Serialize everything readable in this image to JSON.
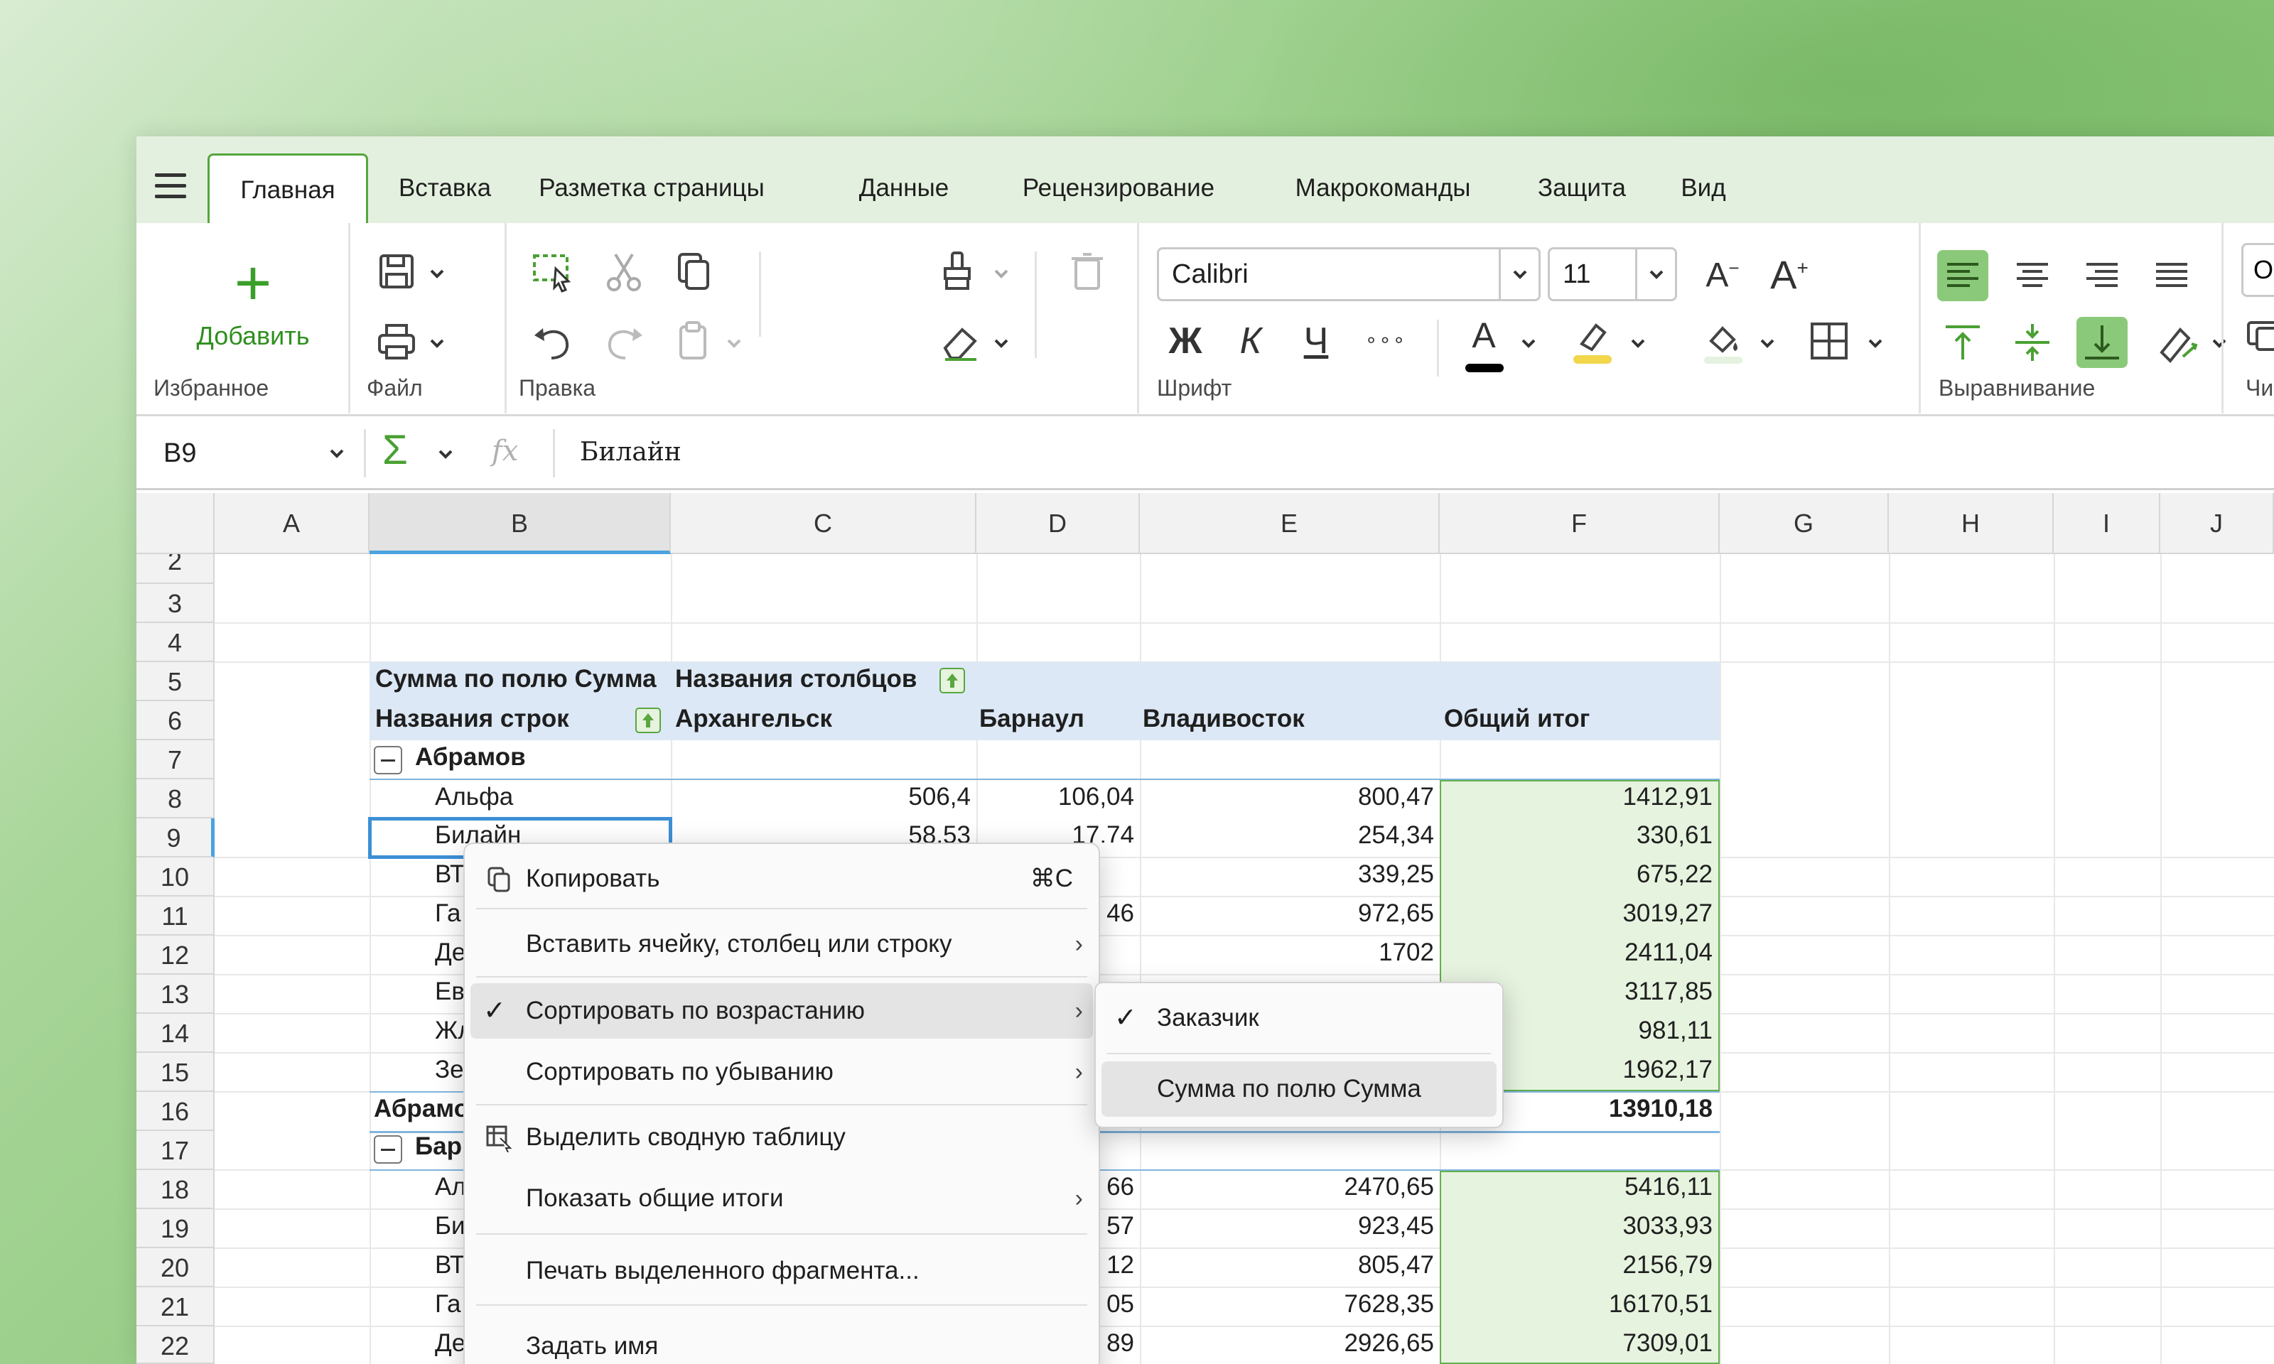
{
  "tabs": [
    {
      "label": "Главная",
      "active": true
    },
    {
      "label": "Вставка"
    },
    {
      "label": "Разметка страницы"
    },
    {
      "label": "Данные"
    },
    {
      "label": "Рецензирование"
    },
    {
      "label": "Макрокоманды"
    },
    {
      "label": "Защита"
    },
    {
      "label": "Вид"
    }
  ],
  "ribbon": {
    "favorites": {
      "add_label": "Добавить",
      "group_label": "Избранное"
    },
    "file": {
      "group_label": "Файл"
    },
    "edit": {
      "group_label": "Правка"
    },
    "font": {
      "group_label": "Шрифт",
      "font_name": "Calibri",
      "font_size": "11",
      "decrease_label": "A",
      "decrease_sup": "−",
      "increase_label": "A",
      "increase_sup": "+",
      "bold": "Ж",
      "italic": "К",
      "underline": "Ч",
      "more": "∘∘∘",
      "font_color": "A",
      "font_color_hex": "#000000",
      "highlight_hex": "#f2d64b"
    },
    "align": {
      "group_label": "Выравнивание"
    },
    "number": {
      "group_label": "Числ",
      "format_value": "Об"
    }
  },
  "formula_bar": {
    "cell_ref": "B9",
    "sum_symbol": "Σ",
    "fx_symbol": "fx",
    "content": "Билайн"
  },
  "columns": [
    "A",
    "B",
    "C",
    "D",
    "E",
    "F",
    "G",
    "H",
    "I",
    "J"
  ],
  "rows": [
    "2",
    "3",
    "4",
    "5",
    "6",
    "7",
    "8",
    "9",
    "10",
    "11",
    "12",
    "13",
    "14",
    "15",
    "16",
    "17",
    "18",
    "19",
    "20",
    "21",
    "22"
  ],
  "pivot": {
    "header_sum_label": "Сумма по полю Сумма",
    "header_cols_label": "Названия столбцов",
    "header_rows_label": "Названия строк",
    "col_names": [
      "Архангельск",
      "Барнаул",
      "Владивосток",
      "Общий итог"
    ],
    "group1": "Абрамов",
    "group1_total_label": "Абрамо",
    "group1_total_value": "13910,18",
    "group2": "Бар",
    "lines": [
      {
        "name": "Альфа",
        "c": "506,4",
        "d": "106,04",
        "e": "800,47",
        "f": "1412,91"
      },
      {
        "name": "Билайн",
        "c": "58,53",
        "d": "17,74",
        "e": "254,34",
        "f": "330,61"
      },
      {
        "name": "ВТ",
        "c": "",
        "d": "",
        "e": "339,25",
        "f": "675,22"
      },
      {
        "name": "Га",
        "c": "",
        "d": "46",
        "e": "972,65",
        "f": "3019,27"
      },
      {
        "name": "Де",
        "c": "",
        "d": "",
        "e": "1702",
        "f": "2411,04"
      },
      {
        "name": "Ев",
        "c": "",
        "d": "",
        "e": "",
        "f": "3117,85"
      },
      {
        "name": "Жл",
        "c": "",
        "d": "",
        "e": "",
        "f": "981,11"
      },
      {
        "name": "Зе",
        "c": "",
        "d": "",
        "e": "",
        "f": "1962,17"
      }
    ],
    "lines2": [
      {
        "name": "Ал",
        "d": "66",
        "e": "2470,65",
        "f": "5416,11"
      },
      {
        "name": "Би",
        "d": "57",
        "e": "923,45",
        "f": "3033,93"
      },
      {
        "name": "ВТ",
        "d": "12",
        "e": "805,47",
        "f": "2156,79"
      },
      {
        "name": "Га",
        "d": "05",
        "e": "7628,35",
        "f": "16170,51"
      },
      {
        "name": "Де",
        "d": "89",
        "e": "2926,65",
        "f": "7309,01"
      }
    ]
  },
  "context_menu": {
    "copy": "Копировать",
    "copy_shortcut": "⌘C",
    "insert": "Вставить ячейку, столбец или строку",
    "sort_asc": "Сортировать по возрастанию",
    "sort_desc": "Сортировать по убыванию",
    "select_pivot": "Выделить сводную таблицу",
    "show_totals": "Показать общие итоги",
    "print_selection": "Печать выделенного фрагмента...",
    "define_name": "Задать имя",
    "arrow": "›",
    "check": "✓"
  },
  "submenu": {
    "customer": "Заказчик",
    "sum_field": "Сумма по полю Сумма"
  },
  "colors": {
    "accent": "#55a63d",
    "selection": "#3d8fd6",
    "pivot_header": "#dce8f5",
    "total_fill": "#e6f3df"
  }
}
